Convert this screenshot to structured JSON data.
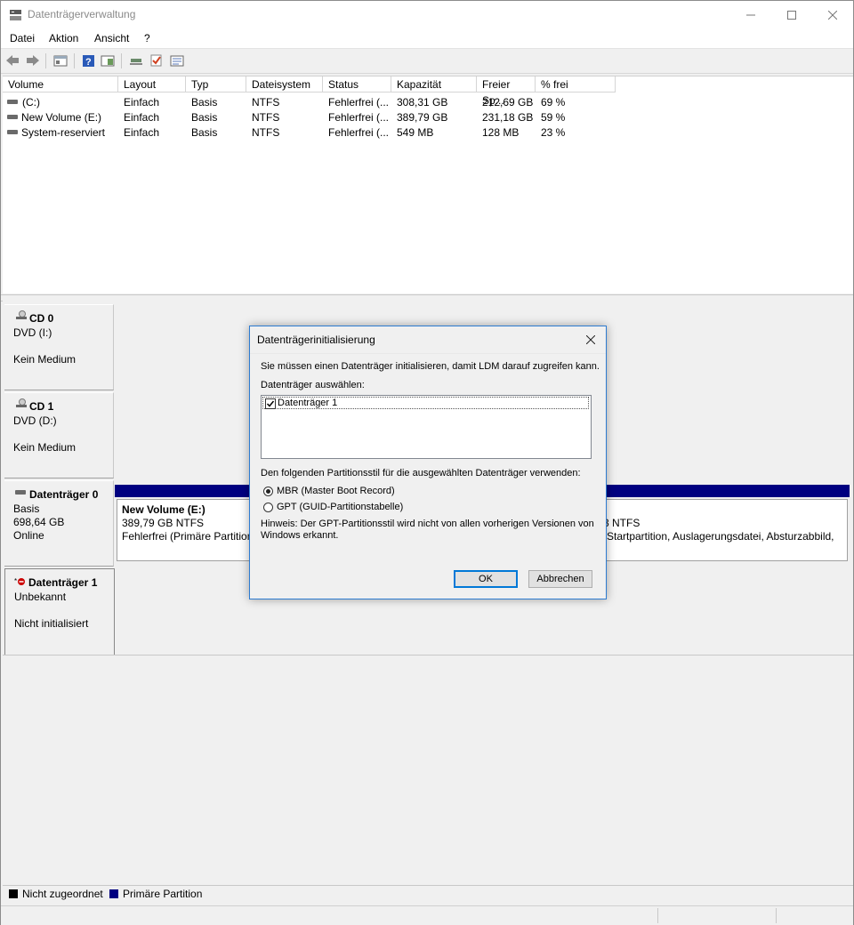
{
  "window": {
    "title": "Datenträgerverwaltung"
  },
  "menu": [
    "Datei",
    "Aktion",
    "Ansicht",
    "?"
  ],
  "columns": [
    "Volume",
    "Layout",
    "Typ",
    "Dateisystem",
    "Status",
    "Kapazität",
    "Freier Sp...",
    "% frei"
  ],
  "volumes": [
    {
      "volume": "(C:)",
      "layout": "Einfach",
      "typ": "Basis",
      "fs": "NTFS",
      "status": "Fehlerfrei (...",
      "cap": "308,31 GB",
      "free": "212,69 GB",
      "pct": "69 %"
    },
    {
      "volume": "New Volume (E:)",
      "layout": "Einfach",
      "typ": "Basis",
      "fs": "NTFS",
      "status": "Fehlerfrei (...",
      "cap": "389,79 GB",
      "free": "231,18 GB",
      "pct": "59 %"
    },
    {
      "volume": "System-reserviert",
      "layout": "Einfach",
      "typ": "Basis",
      "fs": "NTFS",
      "status": "Fehlerfrei (...",
      "cap": "549 MB",
      "free": "128 MB",
      "pct": "23 %"
    }
  ],
  "disks": {
    "cd0": {
      "name": "CD 0",
      "line1": "DVD (I:)",
      "line2": "Kein Medium"
    },
    "cd1": {
      "name": "CD 1",
      "line1": "DVD (D:)",
      "line2": "Kein Medium"
    },
    "disk0": {
      "name": "Datenträger 0",
      "line1": "Basis",
      "line2": "698,64 GB",
      "line3": "Online",
      "part1": {
        "title": "New Volume  (E:)",
        "size": "389,79 GB NTFS",
        "status": "Fehlerfrei (Primäre Partition"
      },
      "part2": {
        "size": "3 NTFS",
        "status": "(Startpartition, Auslagerungsdatei, Absturzabbild,"
      }
    },
    "disk1": {
      "name": "Datenträger 1",
      "line1": "Unbekannt",
      "line2": "Nicht initialisiert"
    }
  },
  "legend": {
    "unallocated": "Nicht zugeordnet",
    "primary": "Primäre Partition",
    "unallocated_color": "#000000",
    "primary_color": "#000080"
  },
  "dialog": {
    "title": "Datenträgerinitialisierung",
    "intro": "Sie müssen einen Datenträger initialisieren, damit LDM darauf zugreifen kann.",
    "select_label": "Datenträger auswählen:",
    "list_item": "Datenträger 1",
    "style_label": "Den folgenden Partitionsstil für die ausgewählten Datenträger verwenden:",
    "mbr": "MBR (Master Boot Record)",
    "gpt": "GPT (GUID-Partitionstabelle)",
    "hint1": "Hinweis: Der GPT-Partitionsstil wird nicht von allen vorherigen Versionen von",
    "hint2": "Windows erkannt.",
    "ok": "OK",
    "cancel": "Abbrechen"
  }
}
